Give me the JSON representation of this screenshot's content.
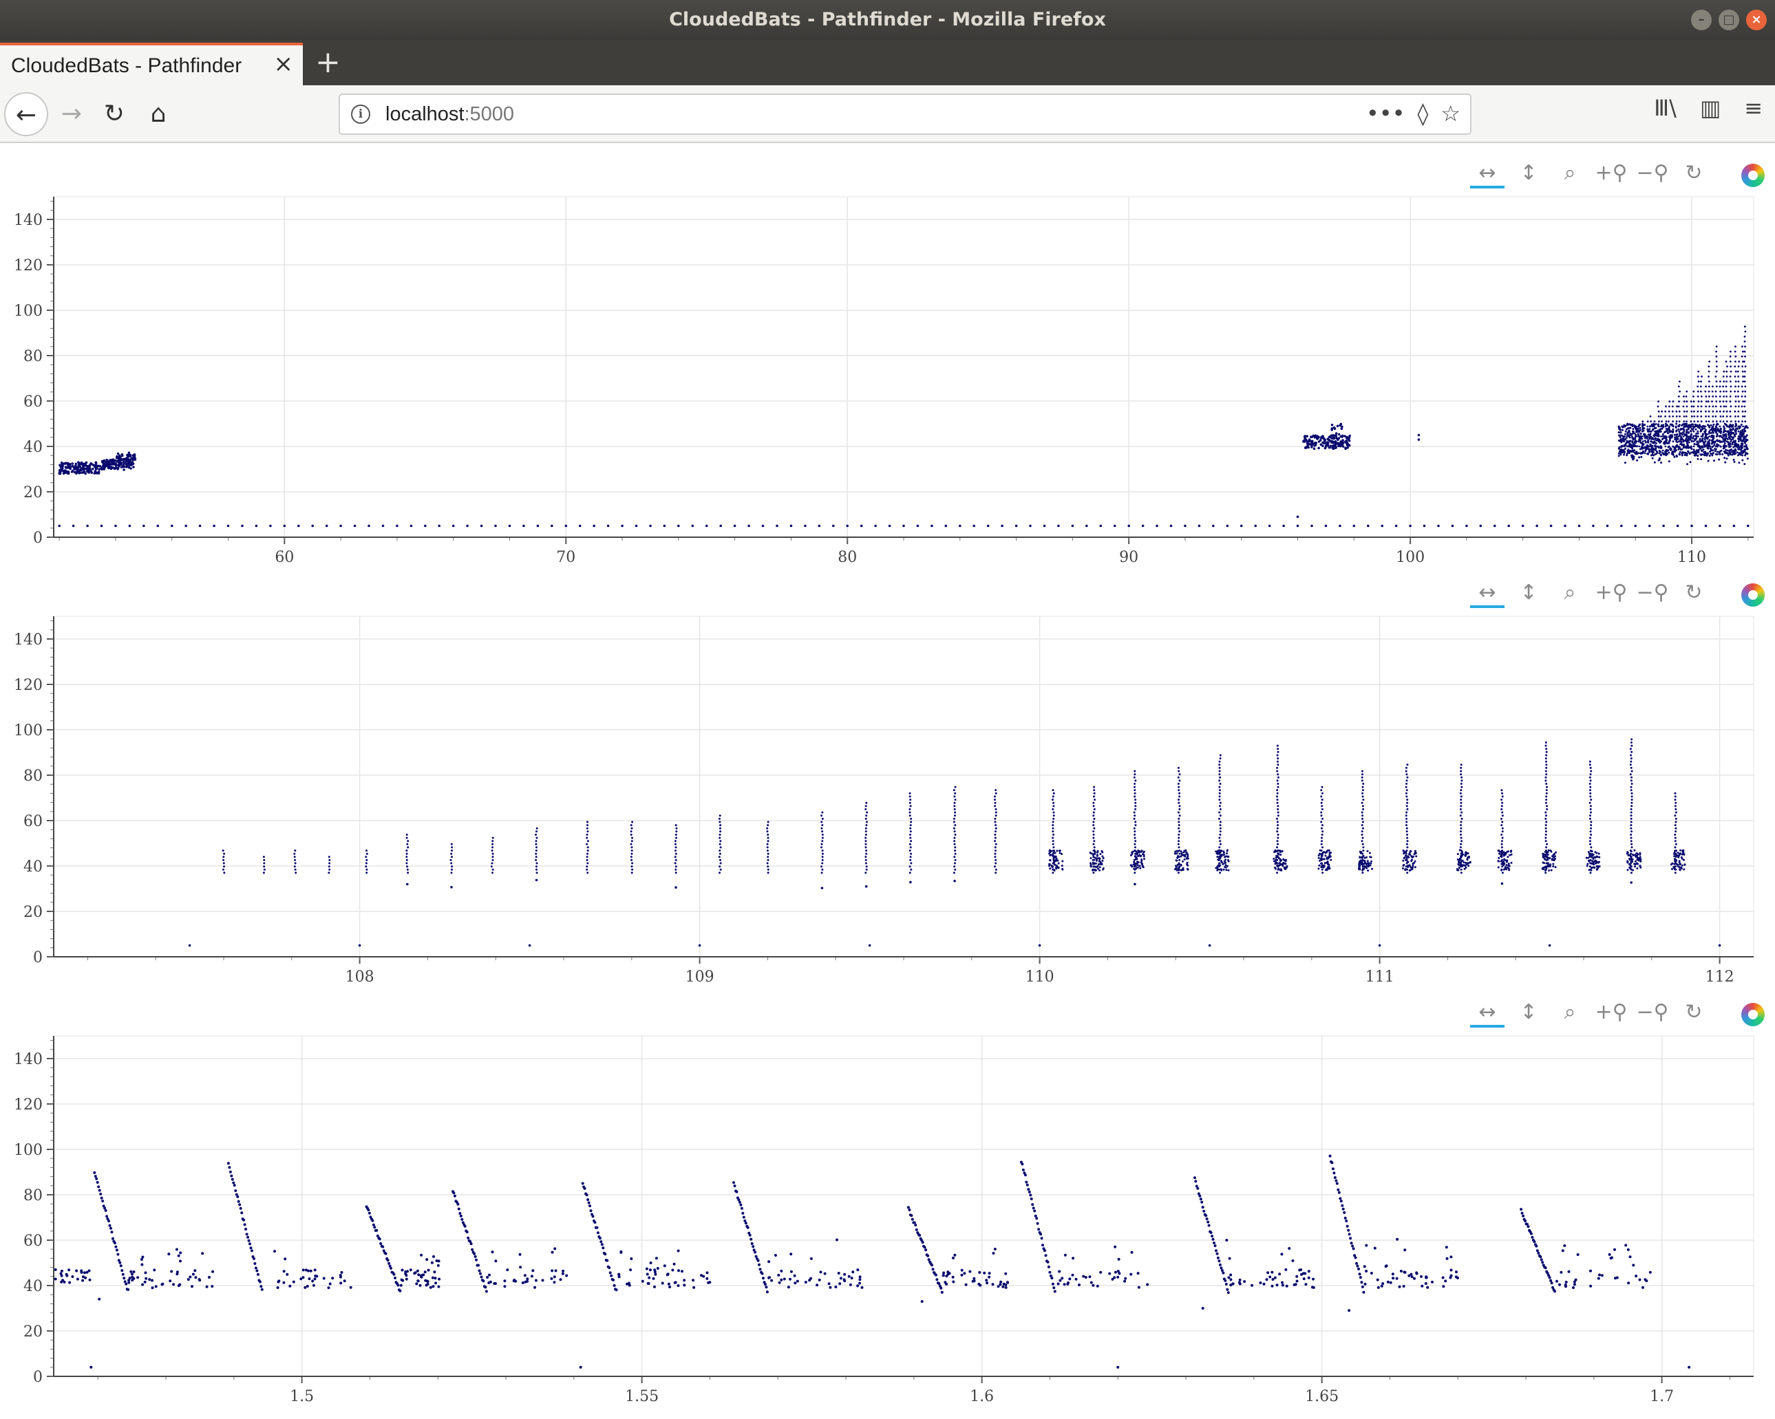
{
  "window": {
    "title": "CloudedBats - Pathfinder - Mozilla Firefox",
    "controls": {
      "minimize": "–",
      "maximize": "□",
      "close": "×"
    }
  },
  "tabs": [
    {
      "label": "CloudedBats - Pathfinder",
      "close": "×"
    }
  ],
  "newtab": "+",
  "nav": {
    "back": "←",
    "forward": "→",
    "reload": "↻",
    "home": "⌂",
    "info": "i",
    "more": "•••",
    "pocket": "◊",
    "bookmark": "☆",
    "library": "Ⅲ\\",
    "sidebar": "▥",
    "menu": "≡"
  },
  "url": {
    "host": "localhost",
    "port": ":5000"
  },
  "toolbar": {
    "pan_x": "↔",
    "pan_y": "↕",
    "box_zoom": "⌕",
    "zoom_in": "+⚲",
    "zoom_out": "−⚲",
    "reset": "↻"
  },
  "colors": {
    "points": "#0a0a6e",
    "grid": "#e5e5e5",
    "tool_active": "#26aae1"
  },
  "chart_data": [
    {
      "type": "scatter",
      "x_ticks": [
        60,
        70,
        80,
        90,
        100,
        110
      ],
      "y_ticks": [
        0,
        20,
        40,
        60,
        80,
        100,
        120,
        140
      ],
      "xlim": [
        51.8,
        112.2
      ],
      "ylim": [
        0,
        150
      ],
      "grid": true,
      "clusters": [
        {
          "x": [
            52,
            54.7
          ],
          "y": [
            27,
            34
          ]
        },
        {
          "x": [
            96.2,
            97.8
          ],
          "y": [
            38,
            48
          ]
        },
        {
          "x": [
            107.5,
            112
          ],
          "y": [
            33,
            60
          ]
        },
        {
          "x": [
            109.5,
            112
          ],
          "y": [
            40,
            97
          ]
        }
      ],
      "baseline": {
        "y": 5,
        "x_start": 52,
        "x_step": 0.5,
        "x_end": 112
      }
    },
    {
      "type": "scatter",
      "x_ticks": [
        108,
        109,
        110,
        111,
        112
      ],
      "y_ticks": [
        0,
        20,
        40,
        60,
        80,
        100,
        120,
        140
      ],
      "xlim": [
        107.1,
        112.1
      ],
      "ylim": [
        0,
        150
      ],
      "grid": true,
      "pulses": [
        {
          "x": 107.6,
          "top": 47
        },
        {
          "x": 107.72,
          "top": 45
        },
        {
          "x": 107.81,
          "top": 47
        },
        {
          "x": 107.91,
          "top": 44
        },
        {
          "x": 108.02,
          "top": 48
        },
        {
          "x": 108.14,
          "top": 55
        },
        {
          "x": 108.27,
          "top": 50
        },
        {
          "x": 108.39,
          "top": 53
        },
        {
          "x": 108.52,
          "top": 57
        },
        {
          "x": 108.67,
          "top": 60
        },
        {
          "x": 108.8,
          "top": 60
        },
        {
          "x": 108.93,
          "top": 58
        },
        {
          "x": 109.06,
          "top": 63
        },
        {
          "x": 109.2,
          "top": 60
        },
        {
          "x": 109.36,
          "top": 64
        },
        {
          "x": 109.49,
          "top": 68
        },
        {
          "x": 109.62,
          "top": 72
        },
        {
          "x": 109.75,
          "top": 75
        },
        {
          "x": 109.87,
          "top": 74
        },
        {
          "x": 110.04,
          "top": 74
        },
        {
          "x": 110.16,
          "top": 76
        },
        {
          "x": 110.28,
          "top": 82
        },
        {
          "x": 110.41,
          "top": 84
        },
        {
          "x": 110.53,
          "top": 90
        },
        {
          "x": 110.7,
          "top": 94
        },
        {
          "x": 110.83,
          "top": 75
        },
        {
          "x": 110.95,
          "top": 82
        },
        {
          "x": 111.08,
          "top": 85
        },
        {
          "x": 111.24,
          "top": 85
        },
        {
          "x": 111.36,
          "top": 74
        },
        {
          "x": 111.49,
          "top": 95
        },
        {
          "x": 111.62,
          "top": 87
        },
        {
          "x": 111.74,
          "top": 97
        },
        {
          "x": 111.87,
          "top": 73
        }
      ],
      "baseline": {
        "y": 5,
        "x_start": 107.5,
        "x_step": 0.5,
        "x_end": 112
      }
    },
    {
      "type": "scatter",
      "x_ticks": [
        1.5,
        1.55,
        1.6,
        1.65,
        1.7
      ],
      "y_ticks": [
        0,
        20,
        40,
        60,
        80,
        100,
        120,
        140
      ],
      "xlim": [
        1.4635,
        1.7135
      ],
      "ylim": [
        0,
        150
      ],
      "grid": true,
      "calls": [
        {
          "x": 1.4695,
          "top": 90
        },
        {
          "x": 1.4892,
          "top": 94
        },
        {
          "x": 1.5095,
          "top": 75
        },
        {
          "x": 1.5222,
          "top": 82
        },
        {
          "x": 1.5413,
          "top": 85
        },
        {
          "x": 1.5635,
          "top": 85
        },
        {
          "x": 1.5892,
          "top": 74
        },
        {
          "x": 1.6058,
          "top": 95
        },
        {
          "x": 1.6313,
          "top": 87
        },
        {
          "x": 1.6512,
          "top": 97
        },
        {
          "x": 1.6793,
          "top": 73
        }
      ],
      "baseline_points": [
        1.469,
        1.541,
        1.62,
        1.704
      ]
    }
  ]
}
